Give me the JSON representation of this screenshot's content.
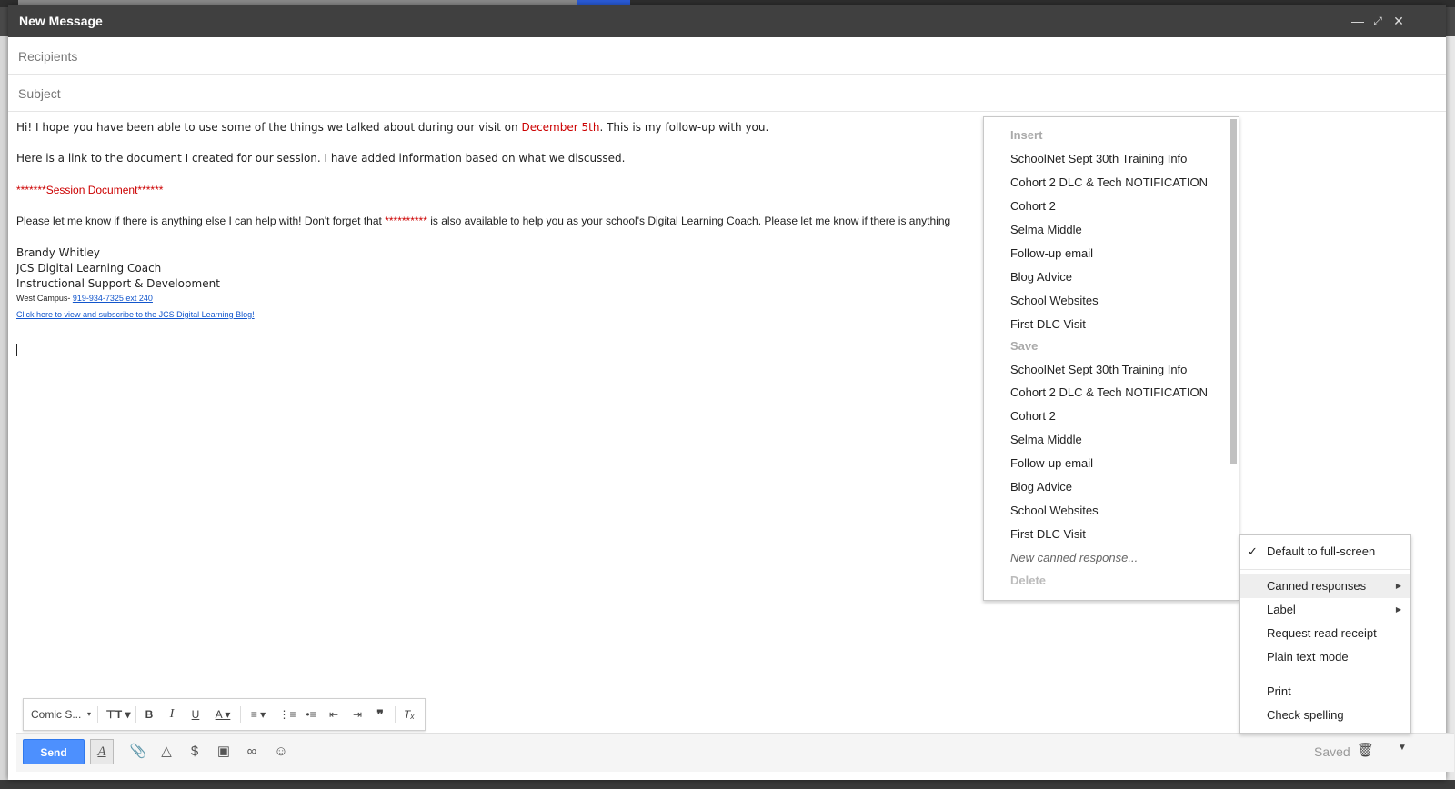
{
  "window": {
    "title": "New Message"
  },
  "fields": {
    "recipients_placeholder": "Recipients",
    "subject_placeholder": "Subject"
  },
  "body": {
    "line1_a": "Hi! I hope you have been able to use some of the things we talked about during our visit on ",
    "line1_date": "December 5th",
    "line1_b": ". This is my follow-up with you.",
    "line2": "Here is a link to the document I created for our session. I have added information based on what we discussed.",
    "session_doc": "*******Session Document******",
    "line4_a": "Please let me know if there is anything else I can help with! Don't forget that ",
    "line4_stars": "**********",
    "line4_b": " is also available to help you as your school's Digital Learning Coach. Please let me know if there is anything",
    "sig_name": "Brandy Whitley",
    "sig_title": "JCS Digital Learning Coach",
    "sig_dept": "Instructional Support & Development",
    "sig_campus": "West Campus- ",
    "sig_phone": "919-934-7325 ext 240",
    "sig_blog": "Click here to view and subscribe to the JCS Digital Learning Blog!"
  },
  "canned_menu": {
    "insert_header": "Insert",
    "insert_items": [
      "SchoolNet Sept 30th Training Info",
      "Cohort 2 DLC & Tech NOTIFICATION",
      "Cohort 2",
      "Selma Middle",
      "Follow-up email",
      "Blog Advice",
      "School Websites",
      "First DLC Visit"
    ],
    "save_header": "Save",
    "save_items": [
      "SchoolNet Sept 30th Training Info",
      "Cohort 2 DLC & Tech NOTIFICATION",
      "Cohort 2",
      "Selma Middle",
      "Follow-up email",
      "Blog Advice",
      "School Websites",
      "First DLC Visit"
    ],
    "new_canned": "New canned response...",
    "delete_header": "Delete"
  },
  "options_menu": {
    "default_fullscreen": "Default to full-screen",
    "canned_responses": "Canned responses",
    "label": "Label",
    "read_receipt": "Request read receipt",
    "plain_text": "Plain text mode",
    "print": "Print",
    "check_spelling": "Check spelling"
  },
  "format_toolbar": {
    "font": "Comic S..."
  },
  "bottom_bar": {
    "send": "Send",
    "saved": "Saved"
  },
  "colors": {
    "send_blue": "#4d90fe",
    "titlebar": "#404040",
    "red_text": "#cc0000",
    "link": "#1155cc"
  }
}
